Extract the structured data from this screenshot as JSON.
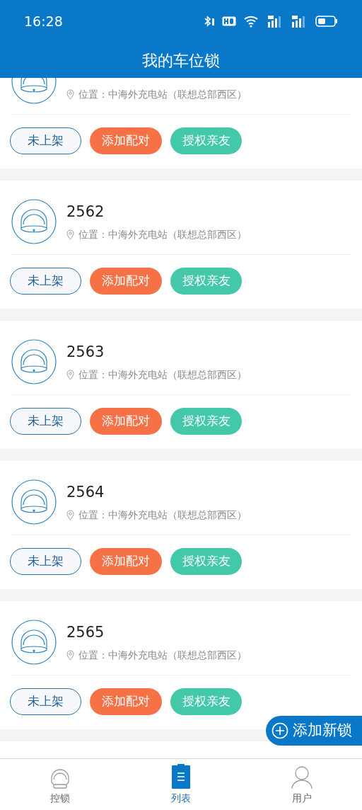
{
  "status_bar": {
    "time": "16:28"
  },
  "header": {
    "title": "我的车位锁"
  },
  "locks": [
    {
      "location": "位置：中海外充电站（联想总部西区）",
      "buttons": [
        {
          "kind": "status",
          "label": "未上架"
        },
        {
          "kind": "pair",
          "label": "添加配对"
        },
        {
          "kind": "share",
          "label": "授权亲友"
        }
      ]
    },
    {
      "number": "2562",
      "location": "位置：中海外充电站（联想总部西区）",
      "buttons": [
        {
          "kind": "status",
          "label": "未上架"
        },
        {
          "kind": "pair",
          "label": "添加配对"
        },
        {
          "kind": "share",
          "label": "授权亲友"
        }
      ]
    },
    {
      "number": "2563",
      "location": "位置：中海外充电站（联想总部西区）",
      "buttons": [
        {
          "kind": "status",
          "label": "未上架"
        },
        {
          "kind": "pair",
          "label": "添加配对"
        },
        {
          "kind": "share",
          "label": "授权亲友"
        }
      ]
    },
    {
      "number": "2564",
      "location": "位置：中海外充电站（联想总部西区）",
      "buttons": [
        {
          "kind": "status",
          "label": "未上架"
        },
        {
          "kind": "pair",
          "label": "添加配对"
        },
        {
          "kind": "share",
          "label": "授权亲友"
        }
      ]
    },
    {
      "number": "2565",
      "location": "位置：中海外充电站（联想总部西区）",
      "buttons": [
        {
          "kind": "status",
          "label": "未上架"
        },
        {
          "kind": "pair",
          "label": "添加配对"
        },
        {
          "kind": "share",
          "label": "授权亲友"
        }
      ]
    }
  ],
  "fab": {
    "label": "添加新锁"
  },
  "tabs": [
    {
      "kind": "lock",
      "label": "控锁",
      "selected": false
    },
    {
      "kind": "list",
      "label": "列表",
      "selected": true
    },
    {
      "kind": "user",
      "label": "用户",
      "selected": false
    }
  ]
}
